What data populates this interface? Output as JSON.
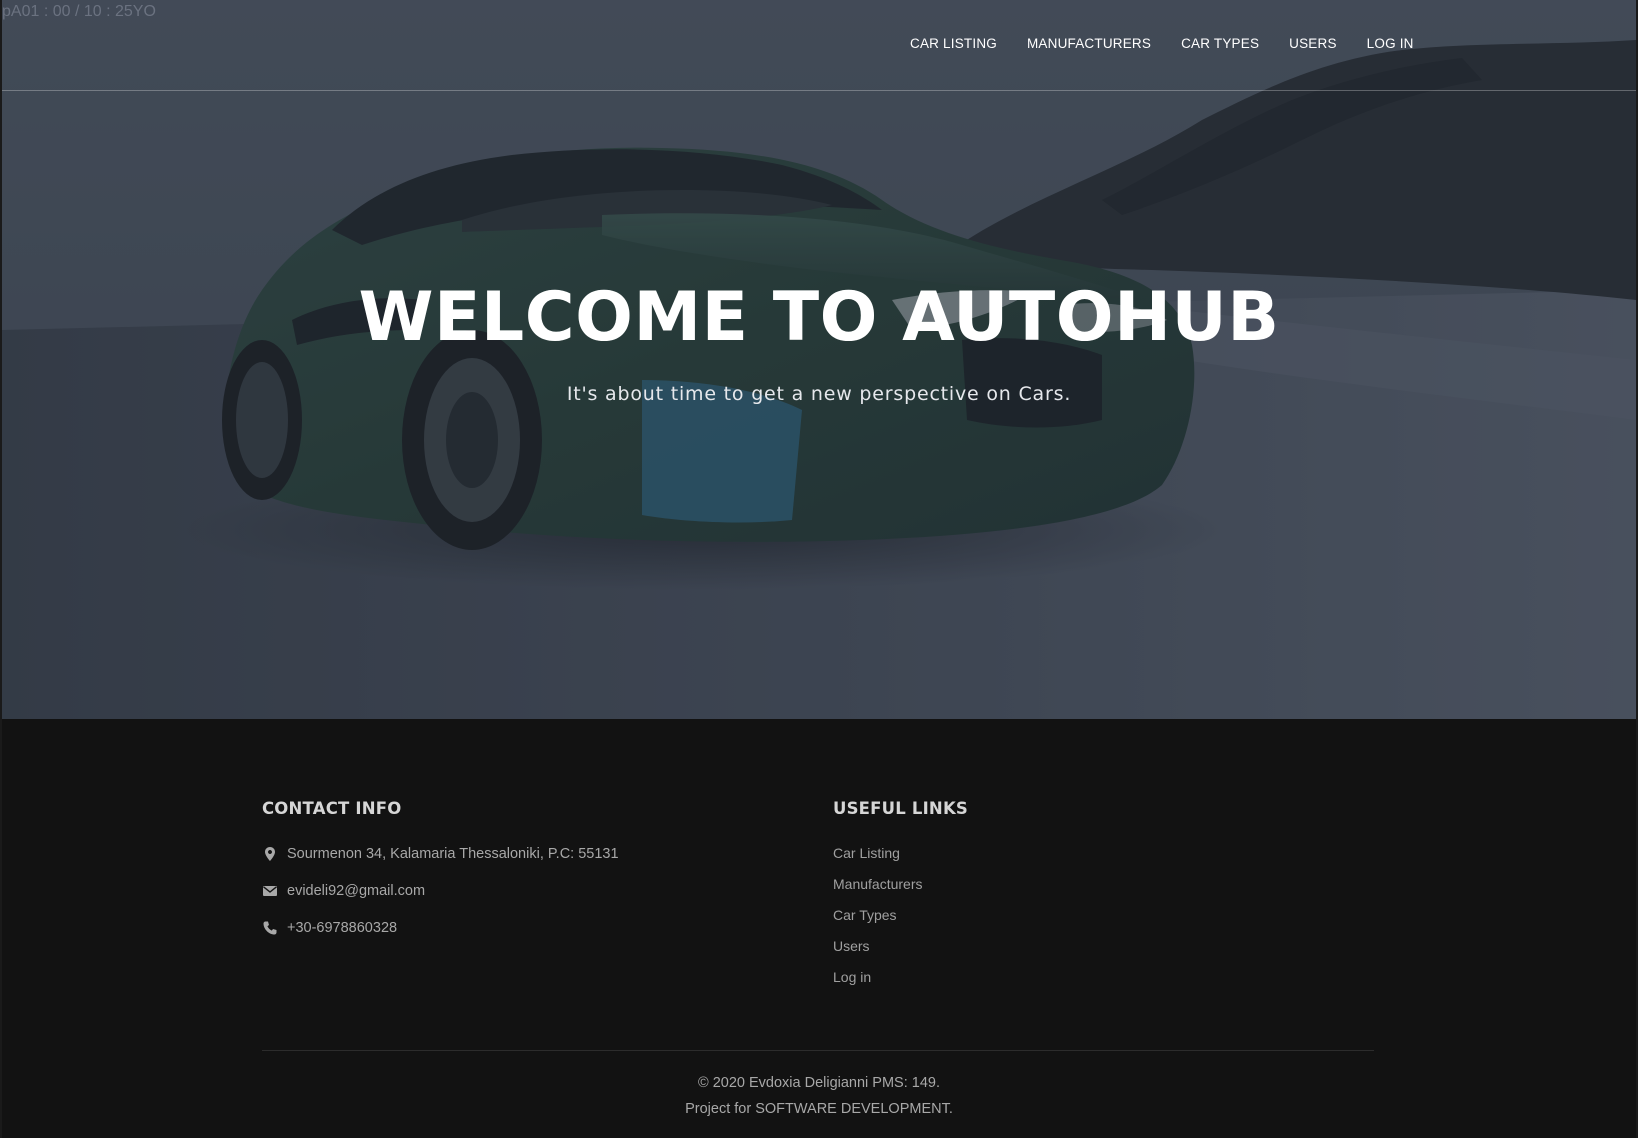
{
  "debug_overlay": "pA01 : 00 / 10 : 25YO",
  "nav": {
    "links": [
      "CAR LISTING",
      "MANUFACTURERS",
      "CAR TYPES",
      "USERS",
      "LOG IN"
    ]
  },
  "hero": {
    "title": "WELCOME TO AUTOHUB",
    "subtitle": "It's about time to get a new perspective on Cars."
  },
  "footer": {
    "contact_heading": "CONTACT INFO",
    "address": "Sourmenon 34, Kalamaria Thessaloniki, P.C: 55131",
    "email": "evideli92@gmail.com",
    "phone": "+30-6978860328",
    "links_heading": "USEFUL LINKS",
    "links": [
      "Car Listing",
      "Manufacturers",
      "Car Types",
      "Users",
      "Log in"
    ],
    "copyright": "© 2020 Evdoxia Deligianni PMS: 149.",
    "project": "Project for SOFTWARE DEVELOPMENT."
  },
  "icons": {
    "address": "map-marker-icon",
    "email": "envelope-icon",
    "phone": "phone-icon"
  },
  "colors": {
    "hero_bg": "#454f5c",
    "footer_bg": "#121212",
    "heading": "#d6d6d6",
    "body_text": "#a8a8a8",
    "nav_text": "#ffffff"
  }
}
